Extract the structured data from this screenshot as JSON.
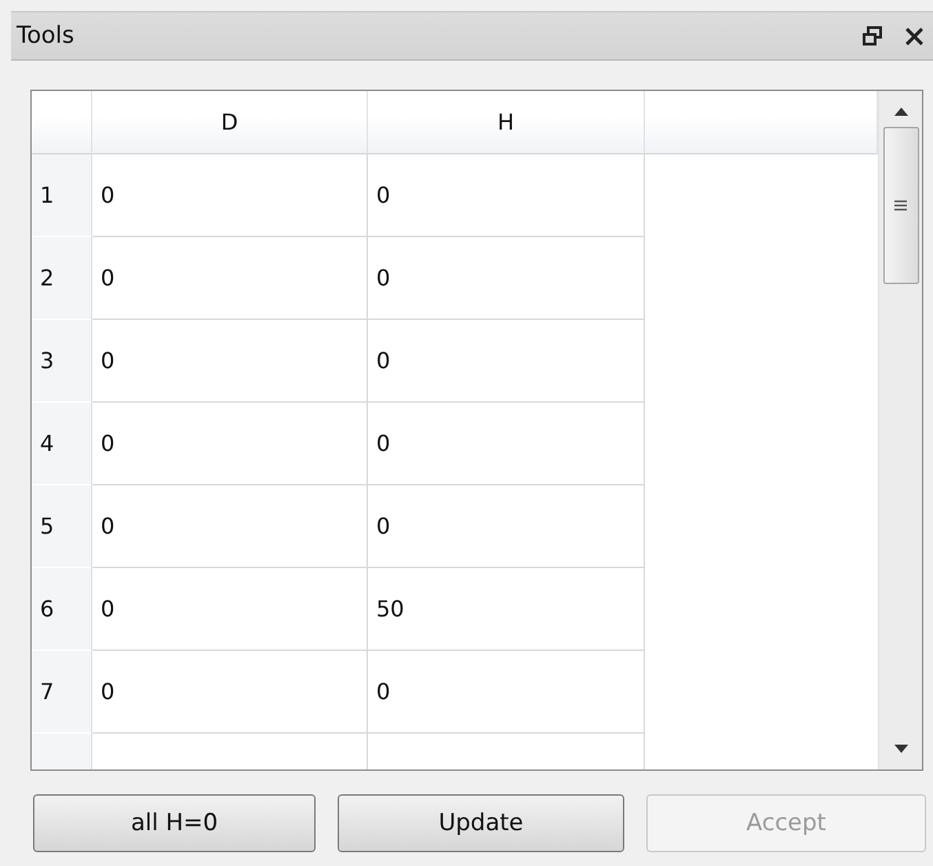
{
  "panel": {
    "title": "Tools"
  },
  "table": {
    "columns": [
      "D",
      "H"
    ],
    "rows": [
      {
        "header": "1",
        "cells": [
          "0",
          "0"
        ]
      },
      {
        "header": "2",
        "cells": [
          "0",
          "0"
        ]
      },
      {
        "header": "3",
        "cells": [
          "0",
          "0"
        ]
      },
      {
        "header": "4",
        "cells": [
          "0",
          "0"
        ]
      },
      {
        "header": "5",
        "cells": [
          "0",
          "0"
        ]
      },
      {
        "header": "6",
        "cells": [
          "0",
          "50"
        ]
      },
      {
        "header": "7",
        "cells": [
          "0",
          "0"
        ]
      },
      {
        "header": "",
        "cells": [
          "",
          ""
        ]
      }
    ]
  },
  "buttons": [
    {
      "label": "all H=0",
      "disabled": false
    },
    {
      "label": "Update",
      "disabled": false
    },
    {
      "label": "Accept",
      "disabled": true
    }
  ]
}
